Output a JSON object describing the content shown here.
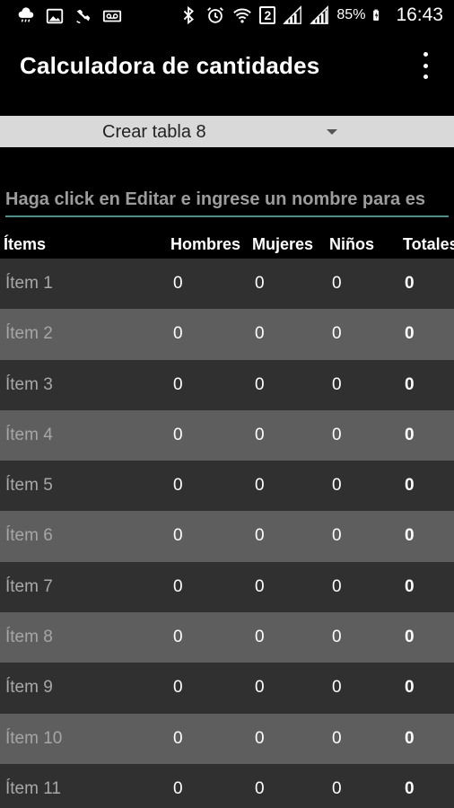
{
  "status_bar": {
    "battery_percent": "85%",
    "time": "16:43",
    "sim_slot": "2",
    "icons": [
      "weather-icon",
      "image-icon",
      "satellite-icon",
      "voicemail-icon",
      "bluetooth-icon",
      "alarm-icon",
      "wifi-icon",
      "signal-icon",
      "battery-icon"
    ]
  },
  "action_bar": {
    "title": "Calculadora de cantidades",
    "overflow_icon": "more-vert-icon"
  },
  "spinner": {
    "selected": "Crear tabla 8"
  },
  "name_input": {
    "placeholder": "Haga click en Editar e ingrese un nombre para es"
  },
  "table": {
    "headers": {
      "items": "Ítems",
      "hombres": "Hombres",
      "mujeres": "Mujeres",
      "ninos": "Niños",
      "totales": "Totales"
    },
    "rows": [
      {
        "name": "Ítem 1",
        "hombres": "0",
        "mujeres": "0",
        "ninos": "0",
        "totales": "0"
      },
      {
        "name": "Ítem 2",
        "hombres": "0",
        "mujeres": "0",
        "ninos": "0",
        "totales": "0"
      },
      {
        "name": "Ítem 3",
        "hombres": "0",
        "mujeres": "0",
        "ninos": "0",
        "totales": "0"
      },
      {
        "name": "Ítem 4",
        "hombres": "0",
        "mujeres": "0",
        "ninos": "0",
        "totales": "0"
      },
      {
        "name": "Ítem 5",
        "hombres": "0",
        "mujeres": "0",
        "ninos": "0",
        "totales": "0"
      },
      {
        "name": "Ítem 6",
        "hombres": "0",
        "mujeres": "0",
        "ninos": "0",
        "totales": "0"
      },
      {
        "name": "Ítem 7",
        "hombres": "0",
        "mujeres": "0",
        "ninos": "0",
        "totales": "0"
      },
      {
        "name": "Ítem 8",
        "hombres": "0",
        "mujeres": "0",
        "ninos": "0",
        "totales": "0"
      },
      {
        "name": "Ítem 9",
        "hombres": "0",
        "mujeres": "0",
        "ninos": "0",
        "totales": "0"
      },
      {
        "name": "Ítem 10",
        "hombres": "0",
        "mujeres": "0",
        "ninos": "0",
        "totales": "0"
      },
      {
        "name": "Ítem 11",
        "hombres": "0",
        "mujeres": "0",
        "ninos": "0",
        "totales": "0"
      }
    ]
  },
  "colors": {
    "background": "#000000",
    "spinner_bg": "#d9d9d9",
    "row_dark": "#303030",
    "row_light": "#5e5e5e",
    "input_underline": "#4f8f88"
  }
}
